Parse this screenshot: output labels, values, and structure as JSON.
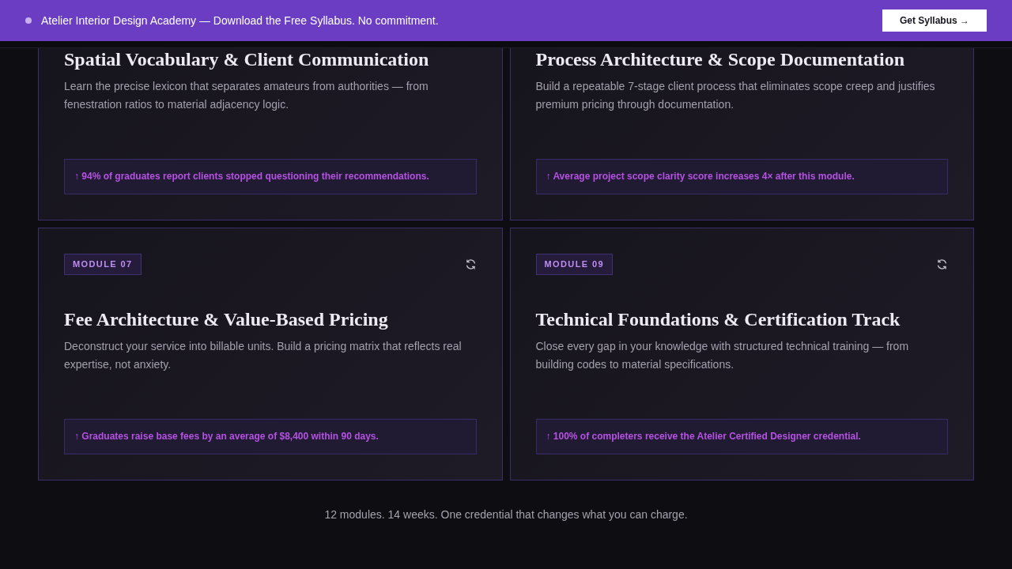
{
  "banner": {
    "text": "Atelier Interior Design Academy — Download the Free Syllabus. No commitment.",
    "button": "Get Syllabus →"
  },
  "modules": [
    {
      "title": "Spatial Vocabulary & Client Communication",
      "description": "Learn the precise lexicon that separates amateurs from authorities — from fenestration ratios to material adjacency logic.",
      "stat": "↑ 94% of graduates report clients stopped questioning their recommendations."
    },
    {
      "title": "Process Architecture & Scope Documentation",
      "description": "Build a repeatable 7-stage client process that eliminates scope creep and justifies premium pricing through documentation.",
      "stat": "↑ Average project scope clarity score increases 4× after this module."
    },
    {
      "badge": "MODULE 07",
      "title": "Fee Architecture & Value-Based Pricing",
      "description": "Deconstruct your service into billable units. Build a pricing matrix that reflects real expertise, not anxiety.",
      "stat": "↑ Graduates raise base fees by an average of $8,400 within 90 days."
    },
    {
      "badge": "MODULE 09",
      "title": "Technical Foundations & Certification Track",
      "description": "Close every gap in your knowledge with structured technical training — from building codes to material specifications.",
      "stat": "↑ 100% of completers receive the Atelier Certified Designer credential."
    }
  ],
  "footer": "12 modules. 14 weeks. One credential that changes what you can charge."
}
